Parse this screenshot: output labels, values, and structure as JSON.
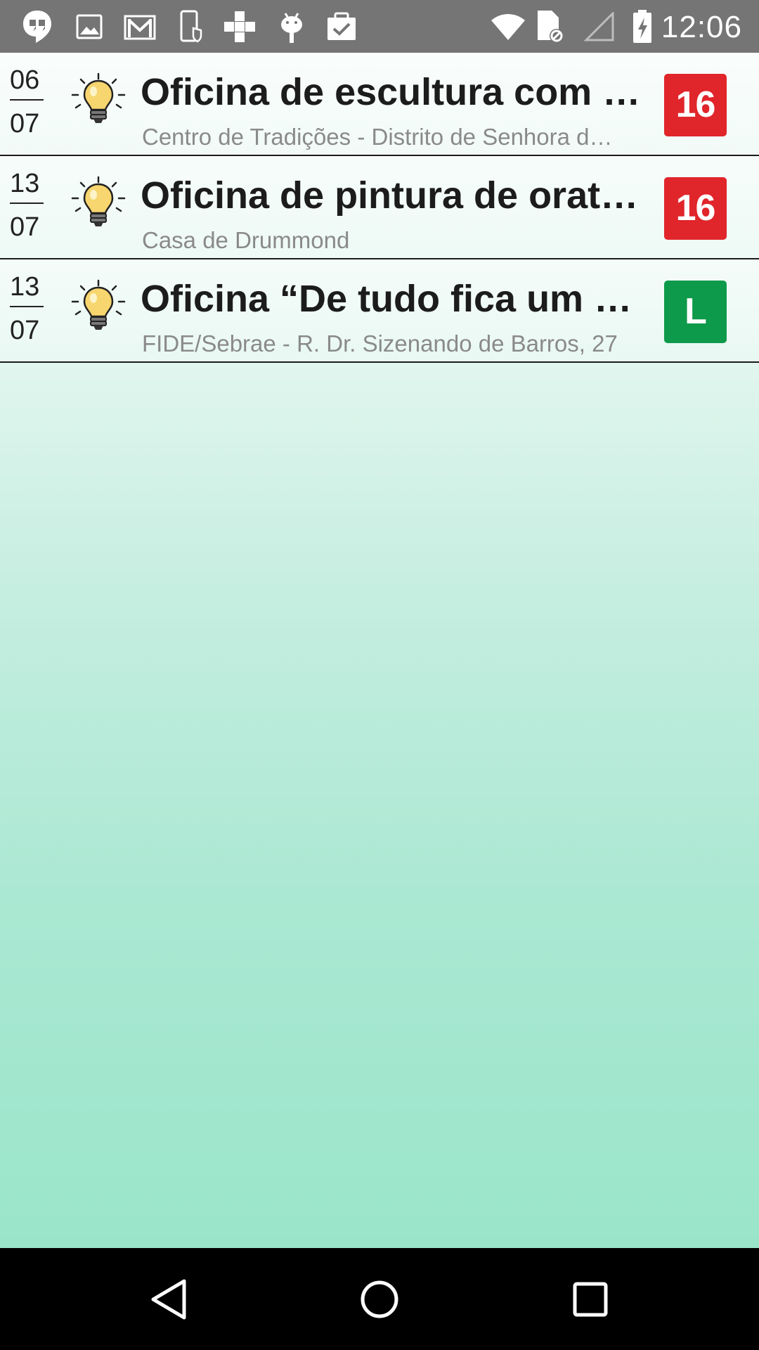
{
  "status_bar": {
    "time": "12:06",
    "left_icons": [
      "hangouts-icon",
      "gallery-icon",
      "gmail-icon",
      "device-security-icon",
      "plus-icon",
      "android-icon",
      "clipboard-check-icon"
    ],
    "right_icons": [
      "wifi-icon",
      "sim-blocked-icon",
      "cell-signal-icon",
      "battery-charging-icon"
    ]
  },
  "events": [
    {
      "day": "06",
      "month": "07",
      "icon": "lightbulb-icon",
      "title": "Oficina de escultura com …",
      "location": "Centro de Tradições - Distrito de Senhora d…",
      "rating": "16",
      "rating_color": "#e0252b"
    },
    {
      "day": "13",
      "month": "07",
      "icon": "lightbulb-icon",
      "title": "Oficina de pintura de orat…",
      "location": "Casa de Drummond",
      "rating": "16",
      "rating_color": "#e0252b"
    },
    {
      "day": "13",
      "month": "07",
      "icon": "lightbulb-icon",
      "title": "Oficina “De tudo fica um p…",
      "location": "FIDE/Sebrae - R. Dr. Sizenando de Barros, 27",
      "rating": "L",
      "rating_color": "#0d9a4a"
    }
  ],
  "nav_bar": {
    "icons": [
      "back-icon",
      "home-icon",
      "recents-icon"
    ]
  }
}
